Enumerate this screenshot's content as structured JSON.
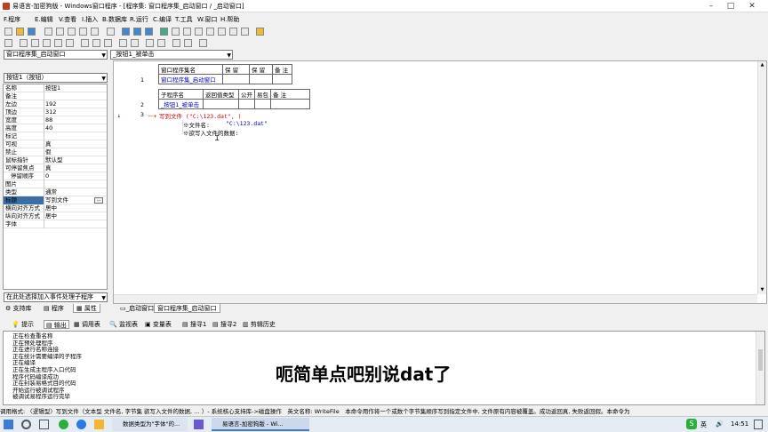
{
  "window": {
    "title": "易语言-加密狗版 - Windows窗口程序 - [程序集: 窗口程序集_启动窗口 / _启动窗口]"
  },
  "menu": [
    "F.程序",
    "E.编辑",
    "V.查看",
    "I.插入",
    "B.数据库",
    "R.运行",
    "C.编译",
    "T.工具",
    "W.窗口",
    "H.帮助"
  ],
  "combos": {
    "left": "窗口程序集_启动窗口",
    "right": "_按钮1_被单击"
  },
  "props": {
    "object_combo": "按钮1（按钮）",
    "rows": [
      {
        "k": "名称",
        "v": "按钮1"
      },
      {
        "k": "备注",
        "v": ""
      },
      {
        "k": "左边",
        "v": "192"
      },
      {
        "k": "顶边",
        "v": "312"
      },
      {
        "k": "宽度",
        "v": "88"
      },
      {
        "k": "高度",
        "v": "40"
      },
      {
        "k": "标记",
        "v": ""
      },
      {
        "k": "可视",
        "v": "真"
      },
      {
        "k": "禁止",
        "v": "假"
      },
      {
        "k": "鼠标指针",
        "v": "默认型"
      },
      {
        "k": "可停留焦点",
        "v": "真"
      },
      {
        "k": "停留顺序",
        "v": "0"
      },
      {
        "k": "图片",
        "v": ""
      },
      {
        "k": "类型",
        "v": "通常"
      },
      {
        "k": "标题",
        "v": "写到文件"
      },
      {
        "k": "横向对齐方式",
        "v": "居中"
      },
      {
        "k": "纵向对齐方式",
        "v": "居中"
      },
      {
        "k": "字体",
        "v": ""
      }
    ],
    "event_combo": "在此处选择加入事件处理子程序",
    "tabs": [
      "支持库",
      "程序",
      "属性"
    ]
  },
  "editor": {
    "t1_headers": [
      "窗口程序集名",
      "保 留",
      "保 留",
      "备 注"
    ],
    "t1_row": "窗口程序集_启动窗口",
    "t1_line": "1",
    "t2_headers": [
      "子程序名",
      "返回值类型",
      "公开",
      "易包",
      "备 注"
    ],
    "t2_row": "_按钮1_被单击",
    "t2_line": "2",
    "line3": "3",
    "code_call": "写到文件 (\"C:\\123.dat\", )",
    "code_param1_label": "※文件名:",
    "code_param1_value": "\"C:\\123.dat\"",
    "code_param2_label": "※欲写入文件的数据:",
    "doc_tabs": [
      "_启动窗口",
      "窗口程序集_启动窗口"
    ]
  },
  "bottom": {
    "tabs": [
      "提示",
      "输出",
      "调用表",
      "监视表",
      "变量表",
      "搜寻1",
      "搜寻2",
      "剪辑历史"
    ],
    "lines": [
      "正在检查重名称",
      "正在预处理程序",
      "正在进行名称连接",
      "正在统计需要编译的子程序",
      "正在编译",
      "正在生成主程序入口代码",
      "程序代码编译成功",
      "正在封装易格式目的代码",
      "开始运行被调试程序",
      "被调试易程序运行完毕"
    ]
  },
  "subtitle": "呃简单点吧别说dat了",
  "status": "调用格式: 〈逻辑型〉写到文件（文本型 文件名, 字节集 欲写入文件的数据, … ）- 系统核心支持库->磁盘操作　英文名称: WriteFile　本命令用作将一个或数个字节集顺序写到指定文件中, 文件原有内容被覆盖。成功返回真, 失败返回假。本命令为",
  "taskbar": {
    "items": [
      "数据类型为\"字体\"的...",
      "易语言-加密狗版 - Wi..."
    ],
    "lang": "英",
    "time": "14:51"
  }
}
